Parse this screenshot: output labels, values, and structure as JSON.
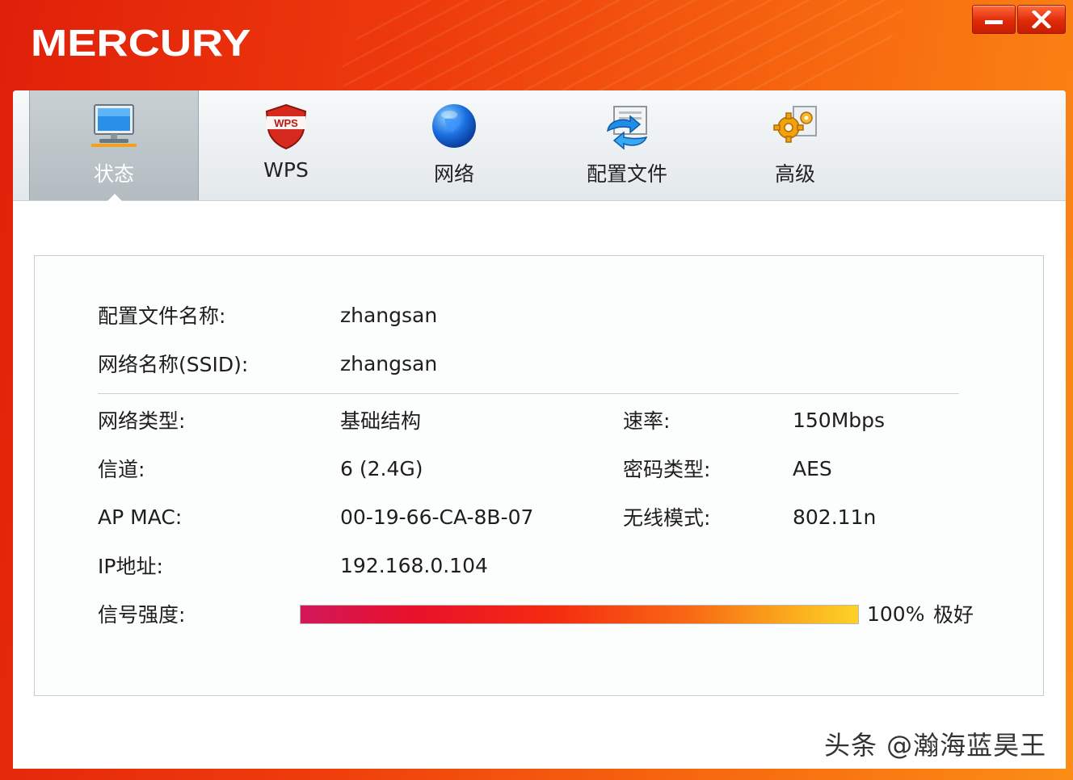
{
  "app": {
    "logo": "MERCURY"
  },
  "window_controls": {
    "minimize": "minimize",
    "close": "close"
  },
  "tabs": [
    {
      "label": "状态",
      "icon": "monitor-icon",
      "active": true
    },
    {
      "label": "WPS",
      "icon": "wps-shield-icon",
      "active": false
    },
    {
      "label": "网络",
      "icon": "globe-icon",
      "active": false
    },
    {
      "label": "配置文件",
      "icon": "profile-arrows-icon",
      "active": false
    },
    {
      "label": "高级",
      "icon": "gears-icon",
      "active": false
    }
  ],
  "status": {
    "profile_name_label": "配置文件名称:",
    "profile_name": "zhangsan",
    "ssid_label": "网络名称(SSID):",
    "ssid": "zhangsan",
    "network_type_label": "网络类型:",
    "network_type": "基础结构",
    "rate_label": "速率:",
    "rate": "150Mbps",
    "channel_label": "信道:",
    "channel": "6 (2.4G)",
    "cipher_label": "密码类型:",
    "cipher": "AES",
    "ap_mac_label": "AP MAC:",
    "ap_mac": "00-19-66-CA-8B-07",
    "wireless_mode_label": "无线模式:",
    "wireless_mode": "802.11n",
    "ip_label": "IP地址:",
    "ip": "192.168.0.104",
    "signal_label": "信号强度:",
    "signal_percent_text": "100%",
    "signal_quality": "极好",
    "signal_level": 1.0
  },
  "watermark": "头条 @瀚海蓝昊王",
  "colors": {
    "title_bar": "#ee3a0c",
    "active_tab": "#b3bcc1"
  }
}
